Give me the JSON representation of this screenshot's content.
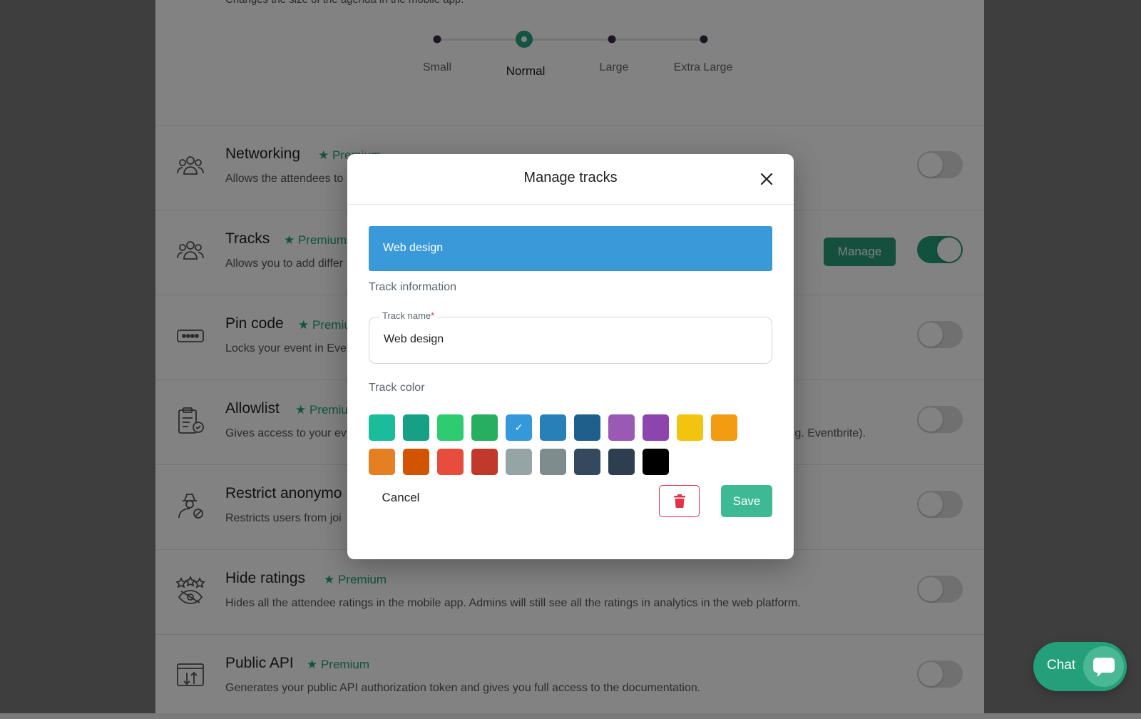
{
  "agenda_size": {
    "description": "Changes the size of the agenda in the mobile app.",
    "options": [
      "Small",
      "Normal",
      "Large",
      "Extra Large"
    ],
    "selected": "Normal"
  },
  "premium_label": "Premium",
  "features": [
    {
      "title": "Networking",
      "description": "Allows the attendees to",
      "enabled": false,
      "icon": "people-icon"
    },
    {
      "title": "Tracks",
      "description": "Allows you to add differ",
      "enabled": true,
      "icon": "people-icon",
      "manage_label": "Manage"
    },
    {
      "title": "Pin code",
      "description": "Locks your event in Ever",
      "enabled": false,
      "icon": "pin-code-icon"
    },
    {
      "title": "Allowlist",
      "description": "Gives access to your ev",
      "description_tail": ".g. Eventbrite).",
      "enabled": false,
      "icon": "clipboard-check-icon"
    },
    {
      "title": "Restrict anonymo",
      "description": "Restricts users from joi",
      "enabled": false,
      "icon": "anonymous-user-icon"
    },
    {
      "title": "Hide ratings",
      "description": "Hides all the attendee ratings in the mobile app. Admins will still see all the ratings in analytics in the web platform.",
      "enabled": false,
      "icon": "hidden-ratings-icon"
    },
    {
      "title": "Public API",
      "description": "Generates your public API authorization token and gives you full access to the documentation.",
      "enabled": false,
      "icon": "api-icon"
    }
  ],
  "modal": {
    "title": "Manage tracks",
    "selected_track": "Web design",
    "section_info": "Track information",
    "field_label": "Track name",
    "field_required_mark": "*",
    "field_value": "Web design",
    "section_color": "Track color",
    "colors": [
      "#1abc9c",
      "#16a085",
      "#2ecc71",
      "#27ae60",
      "#3498db",
      "#2980b9",
      "#1e5f8c",
      "#9b59b6",
      "#8e44ad",
      "#f1c40f",
      "#f39c12",
      "#e67e22",
      "#d35400",
      "#e74c3c",
      "#c0392b",
      "#95a5a6",
      "#7f8c8d",
      "#34495e",
      "#2c3e50",
      "#000000"
    ],
    "selected_color": "#3498db",
    "cancel_label": "Cancel",
    "save_label": "Save"
  },
  "chat": {
    "label": "Chat"
  }
}
